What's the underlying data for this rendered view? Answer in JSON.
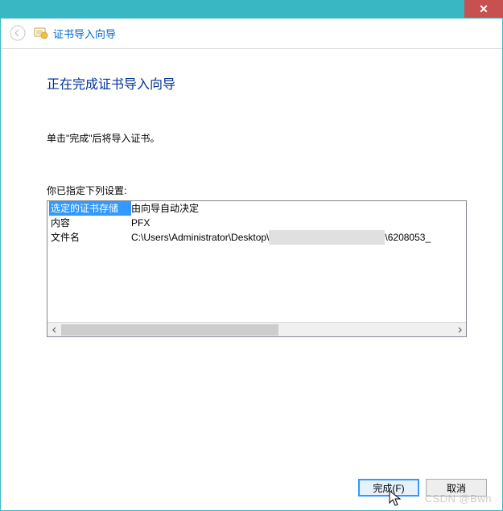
{
  "window": {
    "close_glyph": "✕"
  },
  "header": {
    "title": "证书导入向导"
  },
  "page": {
    "title": "正在完成证书导入向导",
    "instruction": "单击\"完成\"后将导入证书。",
    "settings_label": "你已指定下列设置:"
  },
  "table": {
    "rows": [
      {
        "key": "选定的证书存储",
        "value": "由向导自动决定",
        "selected": true
      },
      {
        "key": "内容",
        "value": "PFX",
        "selected": false
      },
      {
        "key": "文件名",
        "value_prefix": "C:\\Users\\Administrator\\Desktop\\",
        "value_suffix": "\\6208053_",
        "selected": false
      }
    ]
  },
  "buttons": {
    "finish": "完成(F)",
    "cancel": "取消"
  },
  "watermark": "CSDN @Bwn"
}
